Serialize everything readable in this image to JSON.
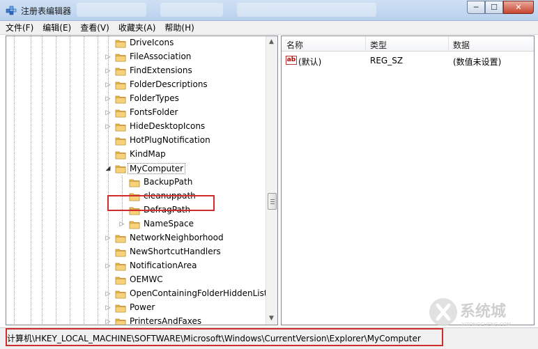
{
  "window": {
    "title": "注册表编辑器",
    "minimize_glyph": "─",
    "maximize_glyph": "☐",
    "close_glyph": "✕"
  },
  "menu": [
    "文件(F)",
    "编辑(E)",
    "查看(V)",
    "收藏夹(A)",
    "帮助(H)"
  ],
  "tree": {
    "items": [
      {
        "label": "DriveIcons",
        "expander": "none",
        "level": 0
      },
      {
        "label": "FileAssociation",
        "expander": "collapsed",
        "level": 0
      },
      {
        "label": "FindExtensions",
        "expander": "collapsed",
        "level": 0
      },
      {
        "label": "FolderDescriptions",
        "expander": "collapsed",
        "level": 0
      },
      {
        "label": "FolderTypes",
        "expander": "collapsed",
        "level": 0
      },
      {
        "label": "FontsFolder",
        "expander": "collapsed",
        "level": 0
      },
      {
        "label": "HideDesktopIcons",
        "expander": "collapsed",
        "level": 0
      },
      {
        "label": "HotPlugNotification",
        "expander": "none",
        "level": 0
      },
      {
        "label": "KindMap",
        "expander": "none",
        "level": 0
      },
      {
        "label": "MyComputer",
        "expander": "expanded",
        "level": 0,
        "selected": true
      },
      {
        "label": "BackupPath",
        "expander": "none",
        "level": 1
      },
      {
        "label": "cleanuppath",
        "expander": "none",
        "level": 1
      },
      {
        "label": "DefragPath",
        "expander": "none",
        "level": 1
      },
      {
        "label": "NameSpace",
        "expander": "collapsed",
        "level": 1
      },
      {
        "label": "NetworkNeighborhood",
        "expander": "collapsed",
        "level": 0
      },
      {
        "label": "NewShortcutHandlers",
        "expander": "none",
        "level": 0
      },
      {
        "label": "NotificationArea",
        "expander": "collapsed",
        "level": 0
      },
      {
        "label": "OEMWC",
        "expander": "none",
        "level": 0
      },
      {
        "label": "OpenContainingFolderHiddenList",
        "expander": "collapsed",
        "level": 0
      },
      {
        "label": "Power",
        "expander": "collapsed",
        "level": 0
      },
      {
        "label": "PrintersAndFaxes",
        "expander": "collapsed",
        "level": 0
      }
    ]
  },
  "list": {
    "columns": [
      "名称",
      "类型",
      "数据"
    ],
    "rows": [
      {
        "icon": "ab",
        "name": "(默认)",
        "type": "REG_SZ",
        "data": "(数值未设置)"
      }
    ]
  },
  "status": {
    "path": "计算机\\HKEY_LOCAL_MACHINE\\SOFTWARE\\Microsoft\\Windows\\CurrentVersion\\Explorer\\MyComputer"
  },
  "watermark": {
    "text": "系统城",
    "subtext": "XITONGCHENG.COM"
  },
  "colors": {
    "highlight_red": "#d12c2c",
    "folder_yellow": "#e8b84a"
  }
}
